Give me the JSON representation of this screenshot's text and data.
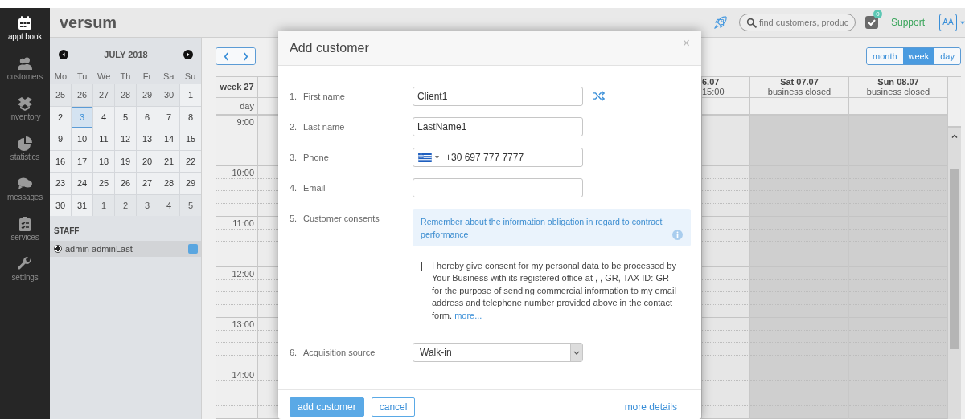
{
  "sidebar": {
    "items": [
      {
        "label": "appt book",
        "selected": true
      },
      {
        "label": "customers",
        "selected": false
      },
      {
        "label": "inventory",
        "selected": false
      },
      {
        "label": "statistics",
        "selected": false
      },
      {
        "label": "messages",
        "selected": false
      },
      {
        "label": "services",
        "selected": false
      },
      {
        "label": "settings",
        "selected": false
      }
    ]
  },
  "header": {
    "logo": "versum",
    "search": {
      "placeholder": "find customers, produc"
    },
    "notifications": {
      "count": "0"
    },
    "support": "Support",
    "user_initials": "AA"
  },
  "mini_calendar": {
    "title": "JULY 2018",
    "weekdays": [
      "Mo",
      "Tu",
      "We",
      "Th",
      "Fr",
      "Sa",
      "Su"
    ],
    "days": [
      {
        "label": "25",
        "other_month": true,
        "selected": false
      },
      {
        "label": "26",
        "other_month": true,
        "selected": false
      },
      {
        "label": "27",
        "other_month": true,
        "selected": false
      },
      {
        "label": "28",
        "other_month": true,
        "selected": false
      },
      {
        "label": "29",
        "other_month": true,
        "selected": false
      },
      {
        "label": "30",
        "other_month": true,
        "selected": false
      },
      {
        "label": "1",
        "other_month": false,
        "selected": false
      },
      {
        "label": "2",
        "other_month": false,
        "selected": false
      },
      {
        "label": "3",
        "other_month": false,
        "selected": true
      },
      {
        "label": "4",
        "other_month": false,
        "selected": false
      },
      {
        "label": "5",
        "other_month": false,
        "selected": false
      },
      {
        "label": "6",
        "other_month": false,
        "selected": false
      },
      {
        "label": "7",
        "other_month": false,
        "selected": false
      },
      {
        "label": "8",
        "other_month": false,
        "selected": false
      },
      {
        "label": "9",
        "other_month": false,
        "selected": false
      },
      {
        "label": "10",
        "other_month": false,
        "selected": false
      },
      {
        "label": "11",
        "other_month": false,
        "selected": false
      },
      {
        "label": "12",
        "other_month": false,
        "selected": false
      },
      {
        "label": "13",
        "other_month": false,
        "selected": false
      },
      {
        "label": "14",
        "other_month": false,
        "selected": false
      },
      {
        "label": "15",
        "other_month": false,
        "selected": false
      },
      {
        "label": "16",
        "other_month": false,
        "selected": false
      },
      {
        "label": "17",
        "other_month": false,
        "selected": false
      },
      {
        "label": "18",
        "other_month": false,
        "selected": false
      },
      {
        "label": "19",
        "other_month": false,
        "selected": false
      },
      {
        "label": "20",
        "other_month": false,
        "selected": false
      },
      {
        "label": "21",
        "other_month": false,
        "selected": false
      },
      {
        "label": "22",
        "other_month": false,
        "selected": false
      },
      {
        "label": "23",
        "other_month": false,
        "selected": false
      },
      {
        "label": "24",
        "other_month": false,
        "selected": false
      },
      {
        "label": "25",
        "other_month": false,
        "selected": false
      },
      {
        "label": "26",
        "other_month": false,
        "selected": false
      },
      {
        "label": "27",
        "other_month": false,
        "selected": false
      },
      {
        "label": "28",
        "other_month": false,
        "selected": false
      },
      {
        "label": "29",
        "other_month": false,
        "selected": false
      },
      {
        "label": "30",
        "other_month": false,
        "selected": false
      },
      {
        "label": "31",
        "other_month": false,
        "selected": false
      },
      {
        "label": "1",
        "other_month": true,
        "selected": false
      },
      {
        "label": "2",
        "other_month": true,
        "selected": false
      },
      {
        "label": "3",
        "other_month": true,
        "selected": false
      },
      {
        "label": "4",
        "other_month": true,
        "selected": false
      },
      {
        "label": "5",
        "other_month": true,
        "selected": false
      }
    ]
  },
  "staff": {
    "title": "STAFF",
    "members": [
      {
        "name": "admin adminLast",
        "selected": true,
        "color": "#5aa6e0"
      }
    ]
  },
  "calendar": {
    "views": [
      {
        "label": "month",
        "selected": false
      },
      {
        "label": "week",
        "selected": true
      },
      {
        "label": "day",
        "selected": false
      }
    ],
    "week_label": "week 27",
    "day_label": "day",
    "cut_column": {
      "date": "6.07",
      "note": "15:00"
    },
    "columns": [
      {
        "date": "Sat 07.07",
        "note": "business closed",
        "closed": true
      },
      {
        "date": "Sun 08.07",
        "note": "business closed",
        "closed": true
      }
    ],
    "times": [
      "9:00",
      "10:00",
      "11:00",
      "12:00",
      "13:00",
      "14:00"
    ]
  },
  "dialog": {
    "title": "Add customer",
    "close": "×",
    "fields": [
      {
        "number": "1.",
        "label": "First name",
        "kind": "text",
        "value": "Client1",
        "shuffle_button": true
      },
      {
        "number": "2.",
        "label": "Last name",
        "kind": "text",
        "value": "LastName1"
      },
      {
        "number": "3.",
        "label": "Phone",
        "kind": "phone",
        "value": "+30 697 777 7777"
      },
      {
        "number": "4.",
        "label": "Email",
        "kind": "text"
      },
      {
        "number": "5.",
        "label": "Customer consents",
        "kind": "consents",
        "info": "Remember about the information obligation in regard to contract performance",
        "consent": {
          "checked": false,
          "text": "I hereby give consent for my personal data to be processed by Your Business with its registered office at , , GR, TAX ID: GR for the purpose of sending commercial information to my email address and telephone number provided above in the contact form.",
          "link": "more..."
        }
      },
      {
        "number": "6.",
        "label": "Acquisition source",
        "kind": "select",
        "value": "Walk-in"
      }
    ],
    "buttons": [
      {
        "label": "add customer",
        "kind": "primary"
      },
      {
        "label": "cancel",
        "kind": "secondary"
      }
    ],
    "link": "more details"
  }
}
